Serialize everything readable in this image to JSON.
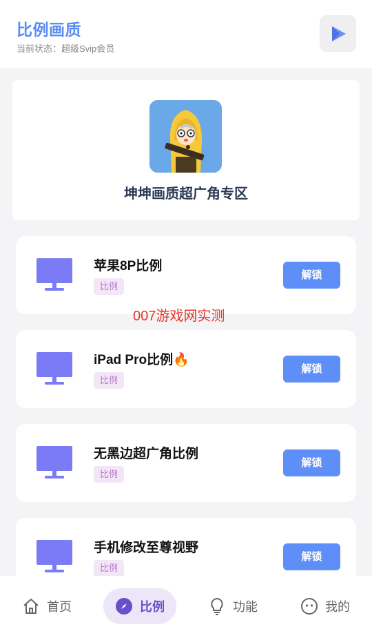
{
  "header": {
    "title": "比例画质",
    "status": "当前状态：超级Svip会员",
    "play_icon": "play-icon"
  },
  "hero": {
    "title": "坤坤画质超广角专区",
    "avatar_icon": "character-avatar"
  },
  "cards": [
    {
      "title": "苹果8P比例",
      "tag": "比例",
      "button": "解锁"
    },
    {
      "title": "iPad Pro比例🔥",
      "tag": "比例",
      "button": "解锁"
    },
    {
      "title": "无黑边超广角比例",
      "tag": "比例",
      "button": "解锁"
    },
    {
      "title": "手机修改至尊视野",
      "tag": "比例",
      "button": "解锁"
    }
  ],
  "watermark": "007游戏网实测",
  "tabs": [
    {
      "label": "首页",
      "icon": "home-icon"
    },
    {
      "label": "比例",
      "icon": "compass-icon",
      "active": true
    },
    {
      "label": "功能",
      "icon": "lightbulb-icon"
    },
    {
      "label": "我的",
      "icon": "face-icon"
    }
  ],
  "colors": {
    "accent": "#5e8ef7",
    "title": "#5b8cf5",
    "monitor": "#7b7bf5",
    "tag_bg": "#f3e6f7",
    "tab_active_bg": "#ebe6f8",
    "watermark": "#e8332a"
  }
}
